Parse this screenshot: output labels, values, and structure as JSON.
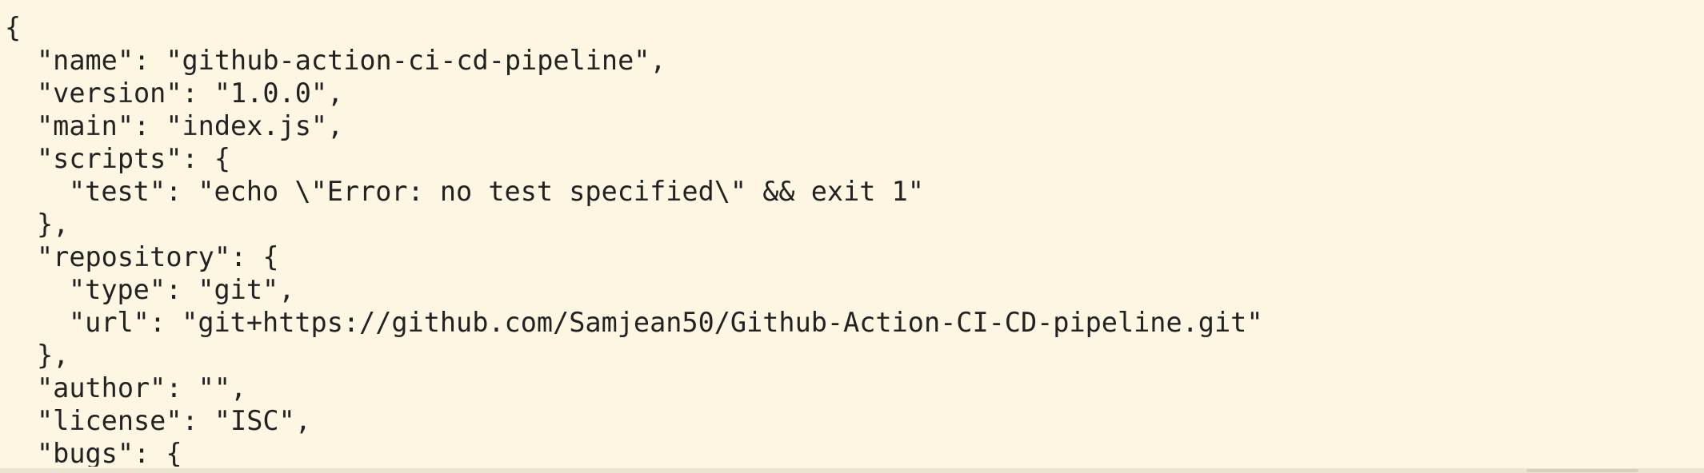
{
  "file": {
    "lines": [
      "{",
      "\"name\": \"github-action-ci-cd-pipeline\",",
      "\"version\": \"1.0.0\",",
      "\"main\": \"index.js\",",
      "\"scripts\": {",
      "\"test\": \"echo \\\"Error: no test specified\\\" && exit 1\"",
      "},",
      "\"repository\": {",
      "\"type\": \"git\",",
      "\"url\": \"git+https://github.com/Samjean50/Github-Action-CI-CD-pipeline.git\"",
      "},",
      "\"author\": \"\",",
      "\"license\": \"ISC\",",
      "\"bugs\": {"
    ]
  },
  "colors": {
    "background": "#fdf6e3",
    "text": "#222222"
  }
}
